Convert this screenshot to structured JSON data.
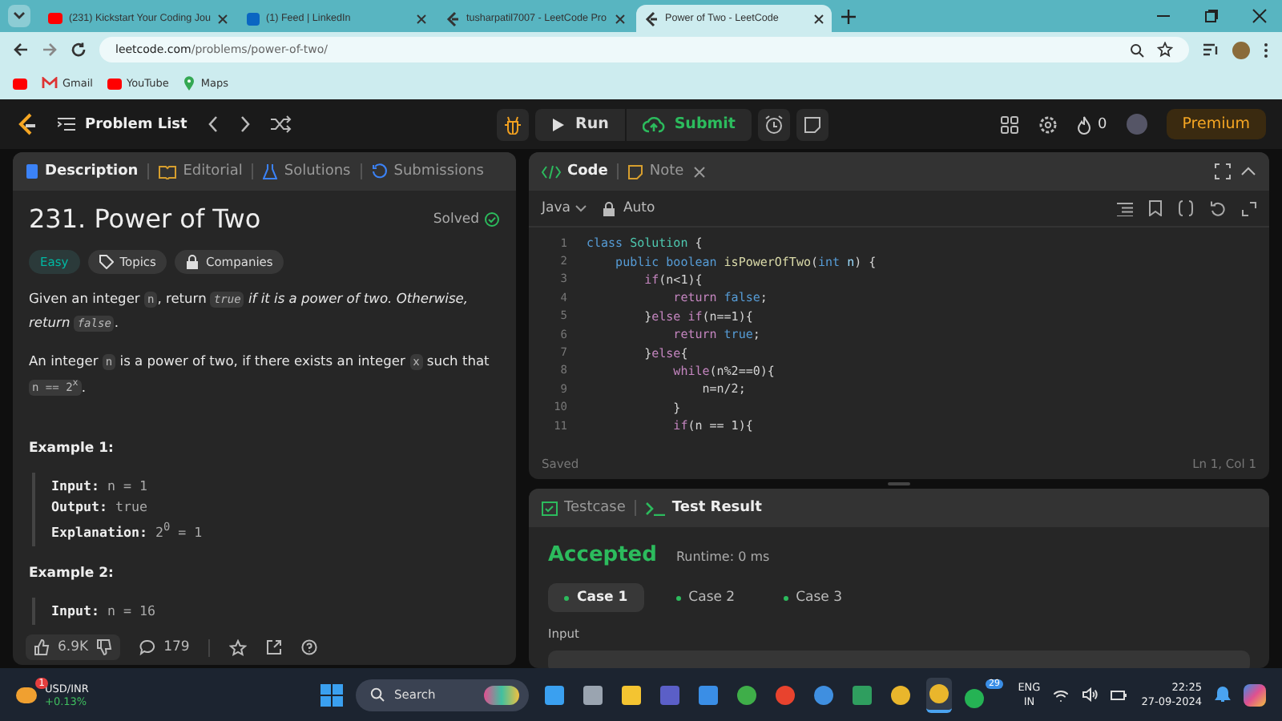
{
  "browser": {
    "tabs": [
      {
        "title": "(231) Kickstart Your Coding Jou",
        "selected": false,
        "kind": "video"
      },
      {
        "title": "(1) Feed | LinkedIn",
        "selected": false,
        "kind": "social"
      },
      {
        "title": "tusharpatil7007 - LeetCode Pro",
        "selected": false,
        "kind": "leetcode"
      },
      {
        "title": "Power of Two - LeetCode",
        "selected": true,
        "kind": "leetcode"
      }
    ],
    "url_host": "leetcode.com",
    "url_path": "/problems/power-of-two/",
    "bookmarks": [
      {
        "kind": "video"
      },
      {
        "label": "Gmail",
        "kind": "mail"
      },
      {
        "label": "YouTube",
        "kind": "video"
      },
      {
        "label": "Maps",
        "kind": "pin"
      }
    ]
  },
  "nav": {
    "problem_list": "Problem List",
    "run": "Run",
    "submit": "Submit",
    "streak": "0",
    "premium": "Premium"
  },
  "description": {
    "tabs": [
      {
        "label": "Description",
        "selected": true,
        "kind": "doc"
      },
      {
        "label": "Editorial",
        "selected": false,
        "kind": "book"
      },
      {
        "label": "Solutions",
        "selected": false,
        "kind": "flask"
      },
      {
        "label": "Submissions",
        "selected": false,
        "kind": "history"
      }
    ],
    "title": "231. Power of Two",
    "status": "Solved",
    "tags": [
      {
        "label": "Easy",
        "kind": "difficulty"
      },
      {
        "label": "Topics",
        "kind": "tag"
      },
      {
        "label": "Companies",
        "kind": "lock"
      }
    ],
    "paragraphs": [
      [
        {
          "text": "Given an integer ",
          "kind": "plain"
        },
        {
          "text": "n",
          "kind": "code"
        },
        {
          "text": ", return ",
          "kind": "plain"
        },
        {
          "text": "true",
          "kind": "codeitalic"
        },
        {
          "text": " if it is a power of two. Otherwise, return ",
          "kind": "italic"
        },
        {
          "text": "false",
          "kind": "codeitalic"
        },
        {
          "text": ".",
          "kind": "plain"
        }
      ],
      [
        {
          "text": "An integer ",
          "kind": "plain"
        },
        {
          "text": "n",
          "kind": "code"
        },
        {
          "text": " is a power of two, if there exists an integer ",
          "kind": "plain"
        },
        {
          "text": "x",
          "kind": "code"
        },
        {
          "text": " such that ",
          "kind": "plain"
        },
        {
          "text": "n == 2$^{x}$",
          "kind": "code"
        },
        {
          "text": ".",
          "kind": "plain"
        }
      ]
    ],
    "examples": [
      {
        "title": "Example 1:",
        "lines": [
          {
            "label": "Input:",
            "value": "n = 1"
          },
          {
            "label": "Output:",
            "value": "true"
          },
          {
            "label": "Explanation:",
            "value": "2$^{0}$ = 1"
          }
        ]
      },
      {
        "title": "Example 2:",
        "lines": [
          {
            "label": "Input:",
            "value": "n = 16"
          }
        ]
      }
    ],
    "likes": "6.9K",
    "comments": "179"
  },
  "code": {
    "tabs": [
      {
        "label": "Code",
        "selected": true,
        "kind": "code"
      },
      {
        "label": "Note",
        "selected": false,
        "kind": "note"
      }
    ],
    "language": "Java",
    "mode": "Auto",
    "lines": [
      {
        "n": "1",
        "tokens": [
          {
            "text": "class ",
            "kind": "kw"
          },
          {
            "text": "Solution",
            "kind": "type"
          },
          {
            "text": " {",
            "kind": "plain"
          }
        ]
      },
      {
        "n": "2",
        "tokens": [
          {
            "text": "    public boolean ",
            "kind": "kw"
          },
          {
            "text": "isPowerOfTwo",
            "kind": "fn"
          },
          {
            "text": "(",
            "kind": "plain"
          },
          {
            "text": "int ",
            "kind": "kw"
          },
          {
            "text": "n",
            "kind": "var"
          },
          {
            "text": ") {",
            "kind": "plain"
          }
        ]
      },
      {
        "n": "3",
        "tokens": [
          {
            "text": "        if",
            "kind": "ctrl"
          },
          {
            "text": "(n<1){",
            "kind": "plain"
          }
        ]
      },
      {
        "n": "4",
        "tokens": [
          {
            "text": "            return ",
            "kind": "ctrl"
          },
          {
            "text": "false",
            "kind": "kw"
          },
          {
            "text": ";",
            "kind": "plain"
          }
        ]
      },
      {
        "n": "5",
        "tokens": [
          {
            "text": "        }",
            "kind": "plain"
          },
          {
            "text": "else if",
            "kind": "ctrl"
          },
          {
            "text": "(n==1){",
            "kind": "plain"
          }
        ]
      },
      {
        "n": "6",
        "tokens": [
          {
            "text": "            return ",
            "kind": "ctrl"
          },
          {
            "text": "true",
            "kind": "kw"
          },
          {
            "text": ";",
            "kind": "plain"
          }
        ]
      },
      {
        "n": "7",
        "tokens": [
          {
            "text": "        }",
            "kind": "plain"
          },
          {
            "text": "else",
            "kind": "ctrl"
          },
          {
            "text": "{",
            "kind": "plain"
          }
        ]
      },
      {
        "n": "8",
        "tokens": [
          {
            "text": "            while",
            "kind": "ctrl"
          },
          {
            "text": "(n%2==0){",
            "kind": "plain"
          }
        ]
      },
      {
        "n": "9",
        "tokens": [
          {
            "text": "                n=n/2;",
            "kind": "plain"
          }
        ]
      },
      {
        "n": "10",
        "tokens": [
          {
            "text": "            }",
            "kind": "plain"
          }
        ]
      },
      {
        "n": "11",
        "tokens": [
          {
            "text": "            if",
            "kind": "ctrl"
          },
          {
            "text": "(n == 1){",
            "kind": "plain"
          }
        ]
      }
    ],
    "saved": "Saved",
    "position": "Ln 1, Col 1"
  },
  "test": {
    "tabs": [
      {
        "label": "Testcase",
        "selected": false,
        "kind": "box"
      },
      {
        "label": "Test Result",
        "selected": true,
        "kind": "terminal"
      }
    ],
    "verdict": "Accepted",
    "runtime": "Runtime: 0 ms",
    "cases": [
      {
        "label": "Case 1",
        "selected": true
      },
      {
        "label": "Case 2",
        "selected": false
      },
      {
        "label": "Case 3",
        "selected": false
      }
    ],
    "input_label": "Input"
  },
  "taskbar": {
    "widget_title": "USD/INR",
    "widget_value": "+0.13%",
    "widget_badge": "1",
    "search": "Search",
    "apps": [
      {
        "kind": "windows",
        "active": false
      },
      {
        "kind": "files",
        "active": false
      },
      {
        "kind": "folder",
        "active": false
      },
      {
        "kind": "teams",
        "active": false
      },
      {
        "kind": "store",
        "active": false
      },
      {
        "kind": "leaf",
        "active": false
      },
      {
        "kind": "office",
        "active": false
      },
      {
        "kind": "globe",
        "active": false
      },
      {
        "kind": "meet",
        "active": false
      },
      {
        "kind": "chrome",
        "active": false
      },
      {
        "kind": "chrome",
        "active": true
      },
      {
        "kind": "chat",
        "active": false,
        "badge": "29"
      }
    ],
    "lang": "ENG",
    "region": "IN",
    "time": "22:25",
    "date": "27-09-2024"
  }
}
